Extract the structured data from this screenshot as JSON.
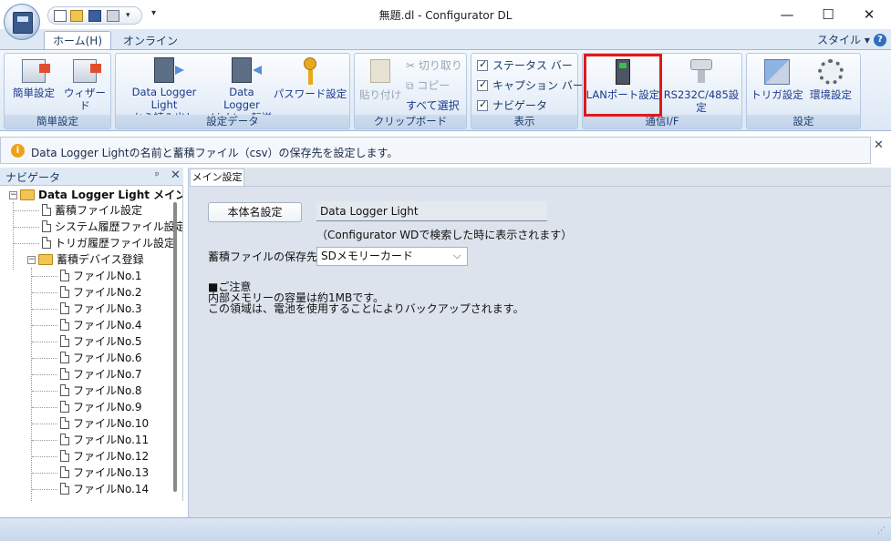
{
  "window": {
    "title": "無題.dl - Configurator DL",
    "minimize_glyph": "—",
    "maximize_glyph": "☐",
    "close_glyph": "✕"
  },
  "ribbon_tabs": {
    "home": "ホーム(H)",
    "online": "オンライン",
    "style": "スタイル ▾",
    "help": "?"
  },
  "ribbon": {
    "groups": {
      "simple": {
        "label": "簡単設定",
        "easy_setup": "簡単設定",
        "wizard": "ウィザード"
      },
      "settings_data": {
        "label": "設定データ",
        "read_line1": "Data Logger Light",
        "read_line2": "から読み出し",
        "transfer_line1": "Data Logger",
        "transfer_line2": "Light へ転送",
        "password": "パスワード設定"
      },
      "clipboard": {
        "label": "クリップボード",
        "paste": "貼り付け",
        "cut": "切り取り",
        "copy": "コピー",
        "select_all": "すべて選択"
      },
      "display": {
        "label": "表示",
        "status_bar": "ステータス バー",
        "caption_bar": "キャプション バー",
        "navigator": "ナビゲータ"
      },
      "comm": {
        "label": "通信I/F",
        "lan": "LANポート設定",
        "rs232": "RS232C/485設定"
      },
      "setup": {
        "label": "設定",
        "trigger": "トリガ設定",
        "environment": "環境設定"
      }
    }
  },
  "infobar": {
    "icon": "i",
    "text": "Data Logger Lightの名前と蓄積ファイル（csv）の保存先を設定します。",
    "close": "✕"
  },
  "navigator": {
    "title": "ナビゲータ",
    "pin": "ᵖ",
    "close": "✕",
    "root": "Data Logger Light メイン設",
    "items": [
      "蓄積ファイル設定",
      "システム履歴ファイル設定",
      "トリガ履歴ファイル設定"
    ],
    "device_folder": "蓄積デバイス登録",
    "files": [
      "ファイルNo.1",
      "ファイルNo.2",
      "ファイルNo.3",
      "ファイルNo.4",
      "ファイルNo.5",
      "ファイルNo.6",
      "ファイルNo.7",
      "ファイルNo.8",
      "ファイルNo.9",
      "ファイルNo.10",
      "ファイルNo.11",
      "ファイルNo.12",
      "ファイルNo.13",
      "ファイルNo.14"
    ]
  },
  "main": {
    "tab": "メイン設定",
    "name_button": "本体名設定",
    "name_value": "Data Logger Light",
    "name_hint": "（Configurator WDで検索した時に表示されます）",
    "save_label": "蓄積ファイルの保存先:",
    "save_value": "SDメモリーカード",
    "note_title": "■ご注意",
    "note_line1": "内部メモリーの容量は約1MBです。",
    "note_line2": "この領域は、電池を使用することによりバックアップされます。"
  },
  "colors": {
    "highlight": "#e0191b",
    "ribbon_text": "#1b3a8a",
    "panel_bg": "#dce3ec"
  }
}
